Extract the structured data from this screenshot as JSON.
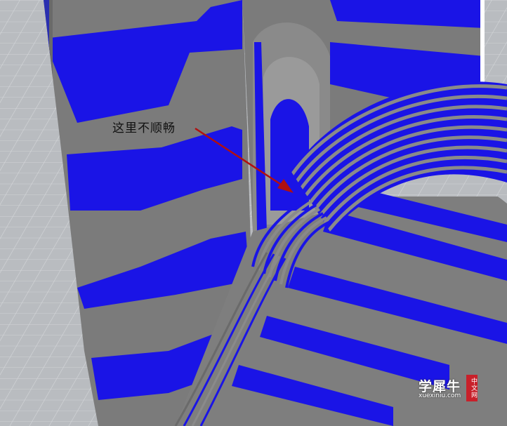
{
  "annotation": {
    "text": "这里不顺畅"
  },
  "watermark": {
    "main": "学犀牛",
    "sub": "xuexiniu.com",
    "badge": "中文网"
  },
  "colors": {
    "stripe_blue": "#1a14e6",
    "stripe_gray": "#7a7a7a",
    "grid_floor": "#b9bcc0",
    "arrow": "#b01010",
    "watermark_badge": "#c8202a"
  },
  "icons": {
    "arrow": "arrow-pointer-icon"
  }
}
